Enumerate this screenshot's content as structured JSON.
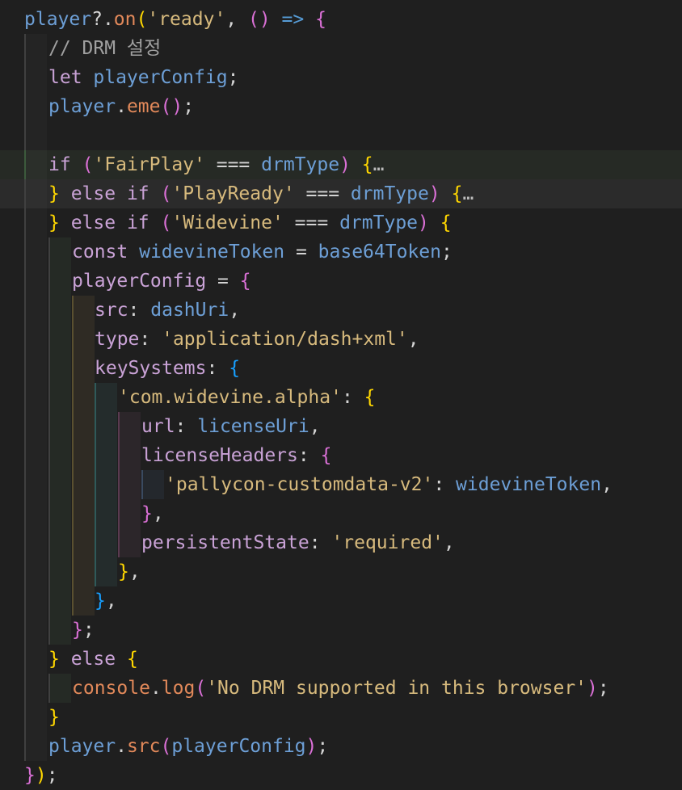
{
  "editor": {
    "lines": [
      [
        "player",
        "?.",
        "on",
        "(",
        "'ready'",
        ", ",
        "()",
        " => ",
        "{"
      ],
      [
        "// DRM 설정"
      ],
      [
        "let ",
        "playerConfig",
        ";"
      ],
      [
        "player",
        ".",
        "eme",
        "()",
        ";"
      ],
      [
        ""
      ],
      [
        "if ",
        "(",
        "'FairPlay'",
        " === ",
        "drmType",
        ")",
        " ",
        "{",
        "…"
      ],
      [
        "}",
        " else if ",
        "(",
        "'PlayReady'",
        " === ",
        "drmType",
        ")",
        " ",
        "{",
        "…"
      ],
      [
        "}",
        " else if ",
        "(",
        "'Widevine'",
        " === ",
        "drmType",
        ")",
        " ",
        "{"
      ],
      [
        "const ",
        "widevineToken",
        " = ",
        "base64Token",
        ";"
      ],
      [
        "playerConfig",
        " = ",
        "{"
      ],
      [
        "src",
        ": ",
        "dashUri",
        ","
      ],
      [
        "type",
        ": ",
        "'application/dash+xml'",
        ","
      ],
      [
        "keySystems",
        ": ",
        "{"
      ],
      [
        "'com.widevine.alpha'",
        ": ",
        "{"
      ],
      [
        "url",
        ": ",
        "licenseUri",
        ","
      ],
      [
        "licenseHeaders",
        ": ",
        "{"
      ],
      [
        "'pallycon-customdata-v2'",
        ": ",
        "widevineToken",
        ","
      ],
      [
        "}",
        ","
      ],
      [
        "persistentState",
        ": ",
        "'required'",
        ","
      ],
      [
        "}",
        ","
      ],
      [
        "}",
        ","
      ],
      [
        "}",
        ";"
      ],
      [
        "}",
        " else ",
        "{"
      ],
      [
        "console",
        ".",
        "log",
        "(",
        "'No DRM supported in this browser'",
        ")",
        ";"
      ],
      [
        "}"
      ],
      [
        "player",
        ".",
        "src",
        "(",
        "playerConfig",
        ")",
        ";"
      ],
      [
        "}",
        ")",
        ";"
      ]
    ]
  }
}
